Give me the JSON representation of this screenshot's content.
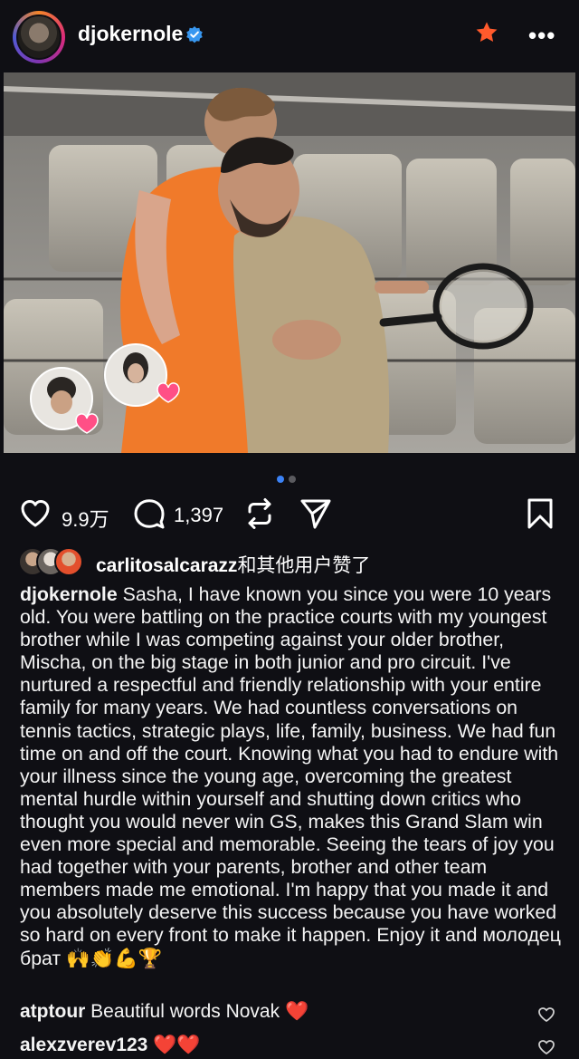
{
  "header": {
    "username": "djokernole",
    "avatar_icon": "profile-avatar",
    "verified_icon": "verified-badge-icon",
    "favorite_icon": "star-icon",
    "more_icon": "more-options-icon",
    "more_label": "•••"
  },
  "photo": {
    "description_icon": "post-photo",
    "sticker_icons": [
      "sticker-avatar-man",
      "sticker-avatar-woman"
    ]
  },
  "carousel": {
    "count": 2,
    "active": 0
  },
  "actions": {
    "like_count": "9.9万",
    "comment_count": "1,397",
    "like_icon": "heart-icon",
    "comment_icon": "comment-icon",
    "repost_icon": "repost-icon",
    "share_icon": "send-icon",
    "save_icon": "bookmark-icon"
  },
  "likes": {
    "user": "carlitosalcarazz",
    "suffix": "和其他用户赞了"
  },
  "caption": {
    "author": "djokernole",
    "text": "Sasha, I have known you since you were 10 years old. You were battling on the practice courts with my youngest brother while I was competing against your older brother, Mischa, on the big stage in both junior and pro circuit. I've nurtured a respectful and friendly relationship with your entire family for many years. We had countless conversations on tennis tactics, strategic plays, life, family, business. We had fun time on and off the court. Knowing what you had to endure with your illness since the young age, overcoming the greatest mental hurdle within yourself and shutting down critics who thought you would never win GS, makes this Grand Slam win even more special and memorable. Seeing the tears of joy you had together with your parents, brother and other team members made me emotional. I'm happy that you made it and you absolutely deserve this success because you have worked so hard on every front to make it happen. Enjoy it and молодец брат",
    "emojis": "🙌👏💪🏆"
  },
  "comments": [
    {
      "user": "atptour",
      "text": "Beautiful words Novak",
      "emoji": "❤️"
    },
    {
      "user": "alexzverev123",
      "text": "",
      "emoji": "❤️❤️"
    }
  ],
  "colors": {
    "background": "#0f0f14",
    "accent_star": "#ff5a2c",
    "verified": "#3897f0",
    "heart_red": "#e0202e",
    "dot_active": "#3b82f6",
    "dot_inactive": "#5a5a5f"
  }
}
